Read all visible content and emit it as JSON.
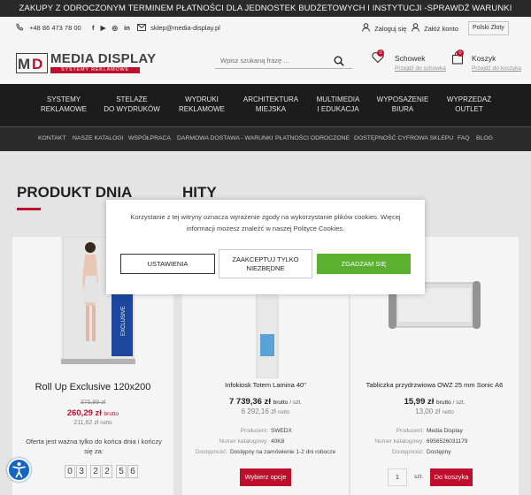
{
  "topbar": {
    "text": "ZAKUPY Z ODROCZONYM TERMINEM PŁATNOŚCI DLA JEDNOSTEK BUDŻETOWYCH I INSTYTUCJI -SPRAWDŹ WARUNKI"
  },
  "contact": {
    "phone": "+48 86 473 78 00",
    "email": "sklep@media-display.pl",
    "login": "Zaloguj się",
    "register": "Załóż konto",
    "currency": "Polski Złoty"
  },
  "brand": {
    "logo_mark": "MD",
    "name": "MEDIA DISPLAY",
    "tagline": "SYSTEMY REKLAMOWE",
    "accent": "#c8102e"
  },
  "search": {
    "placeholder": "Wpisz szukaną frazę ..."
  },
  "wishlist": {
    "label": "Schowek",
    "link": "Przejdź do schowka",
    "count": "0"
  },
  "cart": {
    "label": "Koszyk",
    "link": "Przejdź do koszyka",
    "count": "0"
  },
  "nav": [
    {
      "l1": "SYSTEMY",
      "l2": "REKLAMOWE"
    },
    {
      "l1": "STELAŻE",
      "l2": "DO WYDRUKÓW"
    },
    {
      "l1": "WYDRUKI",
      "l2": "REKLAMOWE"
    },
    {
      "l1": "ARCHITEKTURA",
      "l2": "MIEJSKA"
    },
    {
      "l1": "MULTIMEDIA",
      "l2": "I EDUKACJA"
    },
    {
      "l1": "WYPOSAŻENIE",
      "l2": "BIURA"
    },
    {
      "l1": "WYPRZEDAŻ",
      "l2": "OUTLET"
    }
  ],
  "subnav": [
    "KONTAKT",
    "NASZE KATALOGI",
    "WSPÓŁPRACA",
    "DARMOWA DOSTAWA - WARUNKI",
    "PŁATNOŚCI ODROCZONE",
    "DOSTĘPNOŚĆ CYFROWA SKLEPU",
    "FAQ",
    "BLOG"
  ],
  "sections": {
    "deal": "PRODUKT DNIA",
    "hits": "HITY"
  },
  "deal": {
    "name": "Roll Up Exclusive 120x200",
    "old_price": "375,99 zł",
    "price": "260,29 zł",
    "price_suffix": "brutto",
    "net": "211,62 zł",
    "net_suffix": "netto",
    "offer": "Oferta jest ważna tylko do końca dnia i kończy się za:",
    "timer": [
      "0",
      "3",
      "2",
      "2",
      "5",
      "6"
    ],
    "product_print": "EXCLUSIVE"
  },
  "products": [
    {
      "name": "Infokiosk Totem Lamina 40\"",
      "price": "7 739,36 zł",
      "price_suffix": "brutto",
      "unit": "/ szt.",
      "net": "6 292,16 zł",
      "net_suffix": "netto",
      "producer_label": "Producent:",
      "producer": "SWEDX",
      "catalog_label": "Numer katalogowy:",
      "catalog": "40K8",
      "availability_label": "Dostępność:",
      "availability": "Dostępny na zamówienie 1-2 dni robocze",
      "button": "Wybierz opcje"
    },
    {
      "name": "Tabliczka przydrzwiowa OWZ 25 mm Sonic A6",
      "price": "15,99 zł",
      "price_suffix": "brutto",
      "unit": "/ szt.",
      "net": "13,00 zł",
      "net_suffix": "netto",
      "producer_label": "Producent:",
      "producer": "Media Display",
      "catalog_label": "Numer katalogowy:",
      "catalog": "6956526031179",
      "availability_label": "Dostępność:",
      "availability": "Dostępny",
      "qty": "1",
      "qty_unit": "szt.",
      "button": "Do koszyka"
    }
  ],
  "cookie": {
    "text": "Korzystanie z tej witryny oznacza wyrażenie zgody na wykorzystanie plików cookies. Więcej informacji możesz znaleźć w naszej Polityce Cookies.",
    "settings": "USTAWIENIA",
    "necessary": "ZAAKCEPTUJ TYLKO NIEZBĘDNE",
    "accept": "ZGADZAM SIĘ"
  },
  "colors": {
    "red": "#c8102e",
    "green": "#5cb030",
    "dark": "#1e1e1e",
    "blue": "#1565c0"
  }
}
